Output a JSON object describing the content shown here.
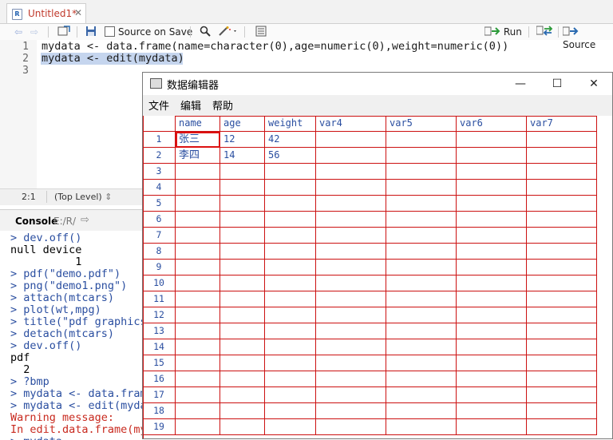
{
  "editor": {
    "tab_title": "Untitled1*",
    "toolbar": {
      "source_on_save": "Source on Save",
      "run": "Run",
      "source": "Source"
    },
    "lines": [
      {
        "num": "1",
        "text": "mydata <- data.frame(name=character(0),age=numeric(0),weight=numeric(0))"
      },
      {
        "num": "2",
        "text": "mydata <- edit(mydata)"
      },
      {
        "num": "3",
        "text": ""
      }
    ],
    "status": {
      "position": "2:1",
      "level": "(Top Level)"
    }
  },
  "console": {
    "title": "Console",
    "path": "E:/R/",
    "lines": [
      {
        "type": "prompt",
        "text": "> dev.off()"
      },
      {
        "type": "out",
        "text": "null device"
      },
      {
        "type": "out",
        "text": "          1"
      },
      {
        "type": "prompt",
        "text": "> pdf(\"demo.pdf\")"
      },
      {
        "type": "prompt",
        "text": "> png(\"demo1.png\")"
      },
      {
        "type": "prompt",
        "text": "> attach(mtcars)"
      },
      {
        "type": "prompt",
        "text": "> plot(wt,mpg)"
      },
      {
        "type": "prompt",
        "text": "> title(\"pdf graphics"
      },
      {
        "type": "prompt",
        "text": "> detach(mtcars)"
      },
      {
        "type": "prompt",
        "text": "> dev.off()"
      },
      {
        "type": "out",
        "text": "pdf"
      },
      {
        "type": "out",
        "text": "  2"
      },
      {
        "type": "prompt",
        "text": "> ?bmp"
      },
      {
        "type": "prompt",
        "text": "> mydata <- data.fram"
      },
      {
        "type": "prompt",
        "text": "> mydata <- edit(myda"
      },
      {
        "type": "err",
        "text": "Warning message:"
      },
      {
        "type": "err",
        "text": "In edit.data.frame(my"
      },
      {
        "type": "prompt",
        "text": "> mydata"
      }
    ]
  },
  "data_editor": {
    "title": "数据编辑器",
    "menu": [
      "文件",
      "编辑",
      "帮助"
    ],
    "columns": [
      "name",
      "age",
      "weight",
      "var4",
      "var5",
      "var6",
      "var7"
    ],
    "rows": [
      {
        "num": "1",
        "cells": [
          "张三",
          "12",
          "42",
          "",
          "",
          "",
          ""
        ]
      },
      {
        "num": "2",
        "cells": [
          "李四",
          "14",
          "56",
          "",
          "",
          "",
          ""
        ]
      },
      {
        "num": "3",
        "cells": [
          "",
          "",
          "",
          "",
          "",
          "",
          ""
        ]
      },
      {
        "num": "4",
        "cells": [
          "",
          "",
          "",
          "",
          "",
          "",
          ""
        ]
      },
      {
        "num": "5",
        "cells": [
          "",
          "",
          "",
          "",
          "",
          "",
          ""
        ]
      },
      {
        "num": "6",
        "cells": [
          "",
          "",
          "",
          "",
          "",
          "",
          ""
        ]
      },
      {
        "num": "7",
        "cells": [
          "",
          "",
          "",
          "",
          "",
          "",
          ""
        ]
      },
      {
        "num": "8",
        "cells": [
          "",
          "",
          "",
          "",
          "",
          "",
          ""
        ]
      },
      {
        "num": "9",
        "cells": [
          "",
          "",
          "",
          "",
          "",
          "",
          ""
        ]
      },
      {
        "num": "10",
        "cells": [
          "",
          "",
          "",
          "",
          "",
          "",
          ""
        ]
      },
      {
        "num": "11",
        "cells": [
          "",
          "",
          "",
          "",
          "",
          "",
          ""
        ]
      },
      {
        "num": "12",
        "cells": [
          "",
          "",
          "",
          "",
          "",
          "",
          ""
        ]
      },
      {
        "num": "13",
        "cells": [
          "",
          "",
          "",
          "",
          "",
          "",
          ""
        ]
      },
      {
        "num": "14",
        "cells": [
          "",
          "",
          "",
          "",
          "",
          "",
          ""
        ]
      },
      {
        "num": "15",
        "cells": [
          "",
          "",
          "",
          "",
          "",
          "",
          ""
        ]
      },
      {
        "num": "16",
        "cells": [
          "",
          "",
          "",
          "",
          "",
          "",
          ""
        ]
      },
      {
        "num": "17",
        "cells": [
          "",
          "",
          "",
          "",
          "",
          "",
          ""
        ]
      },
      {
        "num": "18",
        "cells": [
          "",
          "",
          "",
          "",
          "",
          "",
          ""
        ]
      },
      {
        "num": "19",
        "cells": [
          "",
          "",
          "",
          "",
          "",
          "",
          ""
        ]
      }
    ],
    "active_cell": {
      "row": 1,
      "col": 1
    }
  },
  "colors": {
    "grid_line": "#c11111",
    "cell_text": "#2a4ea0",
    "selection": "#c5d5ee",
    "error_text": "#c8291e"
  }
}
